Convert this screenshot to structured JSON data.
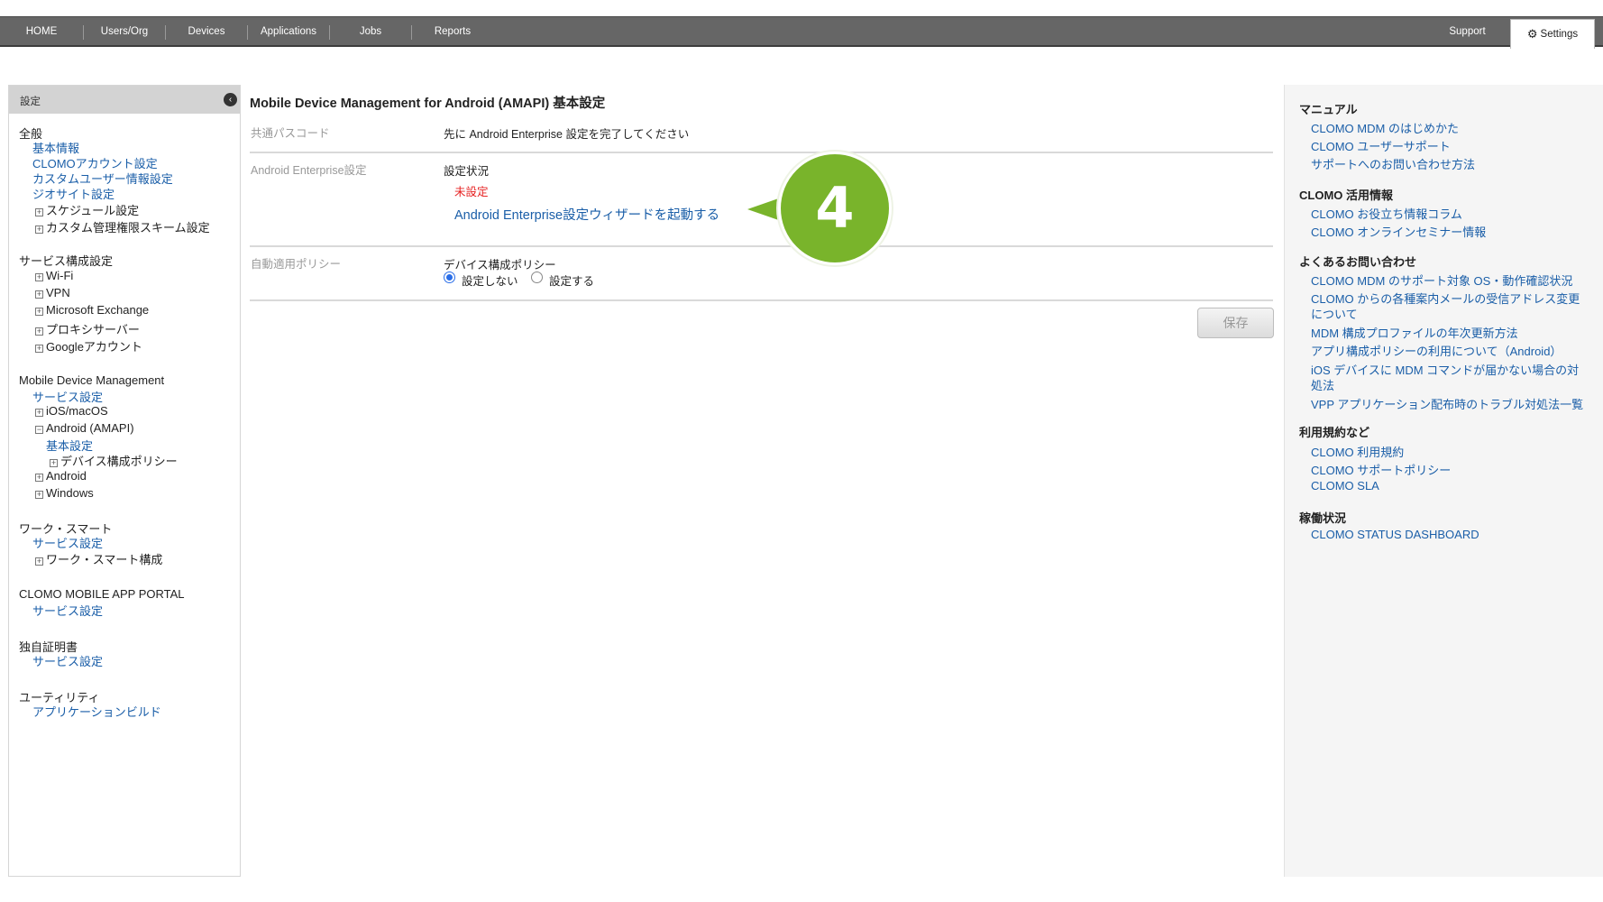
{
  "topnav": {
    "items": [
      "HOME",
      "Users/Org",
      "Devices",
      "Applications",
      "Jobs",
      "Reports"
    ],
    "support": "Support",
    "settings": "Settings"
  },
  "sidebar": {
    "title": "設定",
    "collapse_icon": "‹",
    "sections": {
      "general": "全般",
      "general_links": [
        "基本情報",
        "CLOMOアカウント設定",
        "カスタムユーザー情報設定",
        "ジオサイト設定"
      ],
      "general_tree": [
        "スケジュール設定",
        "カスタム管理権限スキーム設定"
      ],
      "service": "サービス構成設定",
      "service_tree": [
        "Wi-Fi",
        "VPN",
        "Microsoft Exchange",
        "プロキシサーバー",
        "Googleアカウント"
      ],
      "mdm": "Mobile Device Management",
      "mdm_link": "サービス設定",
      "mdm_ios": "iOS/macOS",
      "mdm_android_amapi": "Android (AMAPI)",
      "mdm_basic": "基本設定",
      "mdm_policy": "デバイス構成ポリシー",
      "mdm_android": "Android",
      "mdm_windows": "Windows",
      "work": "ワーク・スマート",
      "work_link": "サービス設定",
      "work_tree": "ワーク・スマート構成",
      "portal": "CLOMO MOBILE APP PORTAL",
      "portal_link": "サービス設定",
      "cert": "独自証明書",
      "cert_link": "サービス設定",
      "util": "ユーティリティ",
      "util_link": "アプリケーションビルド"
    }
  },
  "main": {
    "title": "Mobile Device Management for Android (AMAPI) 基本設定",
    "passcode_label": "共通パスコード",
    "passcode_value": "先に Android Enterprise 設定を完了してください",
    "ae_label": "Android Enterprise設定",
    "ae_status_label": "設定状況",
    "ae_status_value": "未設定",
    "ae_wizard_link": "Android Enterprise設定ウィザードを起動する",
    "policy_label": "自動適用ポリシー",
    "policy_sub": "デバイス構成ポリシー",
    "radio_off": "設定しない",
    "radio_on": "設定する",
    "radio_selected": "設定しない",
    "save": "保存"
  },
  "callout": {
    "number": "4",
    "color": "#79b42b"
  },
  "rightbar": {
    "manual_head": "マニュアル",
    "manual_links": [
      "CLOMO MDM のはじめかた",
      "CLOMO ユーザーサポート",
      "サポートへのお問い合わせ方法"
    ],
    "info_head": "CLOMO 活用情報",
    "info_links": [
      "CLOMO お役立ち情報コラム",
      "CLOMO オンラインセミナー情報"
    ],
    "faq_head": "よくあるお問い合わせ",
    "faq_links": [
      "CLOMO MDM のサポート対象 OS・動作確認状況",
      "CLOMO からの各種案内メールの受信アドレス変更",
      "について",
      "MDM 構成プロファイルの年次更新方法",
      "アプリ構成ポリシーの利用について（Android）",
      "iOS デバイスに MDM コマンドが届かない場合の対",
      "処法",
      "VPP アプリケーション配布時のトラブル対処法一覧"
    ],
    "terms_head": "利用規約など",
    "terms_links": [
      "CLOMO 利用規約",
      "CLOMO サポートポリシー",
      "CLOMO SLA"
    ],
    "status_head": "稼働状況",
    "status_links": [
      "CLOMO STATUS DASHBOARD"
    ]
  },
  "colors": {
    "nav_bg": "#666666",
    "link": "#1a5ea8",
    "alert": "#e62020",
    "callout": "#79b42b"
  }
}
